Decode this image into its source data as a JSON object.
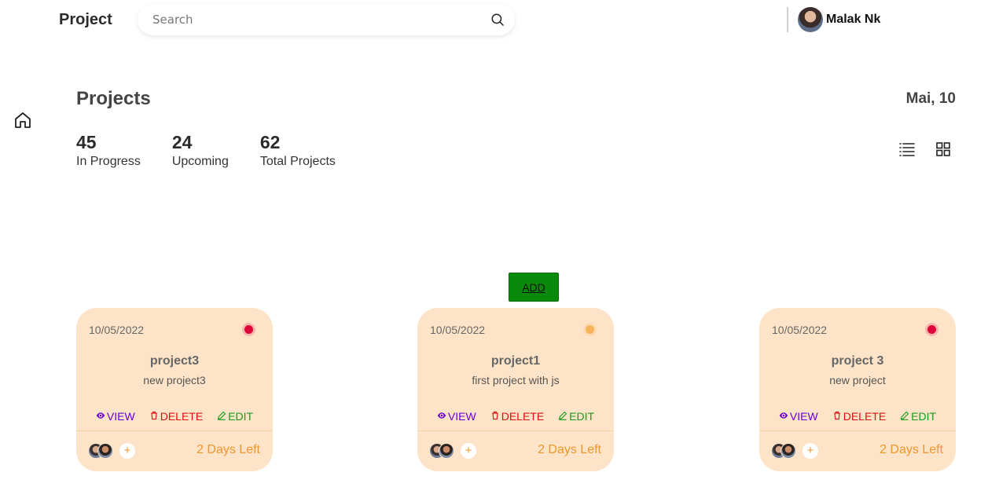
{
  "header": {
    "title": "Project",
    "search_placeholder": "Search",
    "search_value": "",
    "user_name": "Malak Nk"
  },
  "page": {
    "title": "Projects",
    "date": "Mai, 10"
  },
  "stats": [
    {
      "value": "45",
      "label": "In Progress"
    },
    {
      "value": "24",
      "label": "Upcoming"
    },
    {
      "value": "62",
      "label": "Total Projects"
    }
  ],
  "add_label": "ADD",
  "cards": [
    {
      "date": "10/05/2022",
      "name": "project3",
      "description": "new project3",
      "status_color": "#e0063a",
      "view": "VIEW",
      "delete": "DELETE",
      "edit": "EDIT",
      "days_left": "2 Days Left"
    },
    {
      "date": "10/05/2022",
      "name": "project1",
      "description": "first project with js",
      "status_color": "#f8b45a",
      "view": "VIEW",
      "delete": "DELETE",
      "edit": "EDIT",
      "days_left": "2 Days Left"
    },
    {
      "date": "10/05/2022",
      "name": "project 3",
      "description": "new project",
      "status_color": "#e0063a",
      "view": "VIEW",
      "delete": "DELETE",
      "edit": "EDIT",
      "days_left": "2 Days Left"
    }
  ],
  "colors": {
    "card_bg": "#fde4c8",
    "accent_orange": "#f0962a",
    "add_green": "#0a8a0a",
    "view_purple": "#6a00d6",
    "delete_red": "#e01010",
    "edit_green": "#1a9a1a"
  },
  "icons": [
    "search-icon",
    "home-icon",
    "list-view-icon",
    "grid-view-icon",
    "eye-icon",
    "trash-icon",
    "pencil-icon",
    "plus-icon"
  ]
}
